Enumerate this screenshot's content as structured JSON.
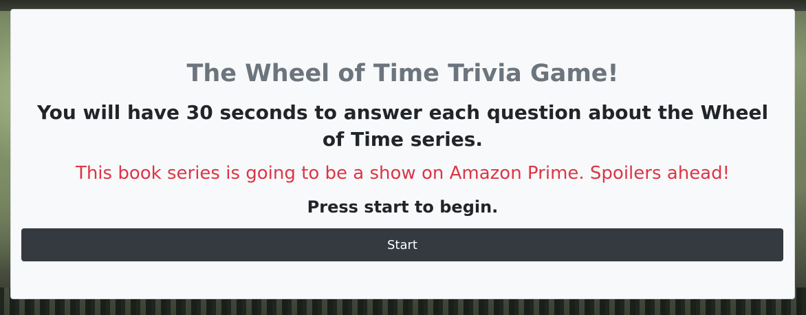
{
  "game": {
    "title": "The Wheel of Time Trivia Game!",
    "instructions": "You will have 30 seconds to answer each question about the Wheel of Time series.",
    "warning": "This book series is going to be a show on Amazon Prime. Spoilers ahead!",
    "prompt": "Press start to begin.",
    "start_label": "Start"
  },
  "colors": {
    "title": "#6c757d",
    "warning": "#dc3545",
    "button_bg": "#343a40",
    "card_bg": "#f8f9fa"
  }
}
